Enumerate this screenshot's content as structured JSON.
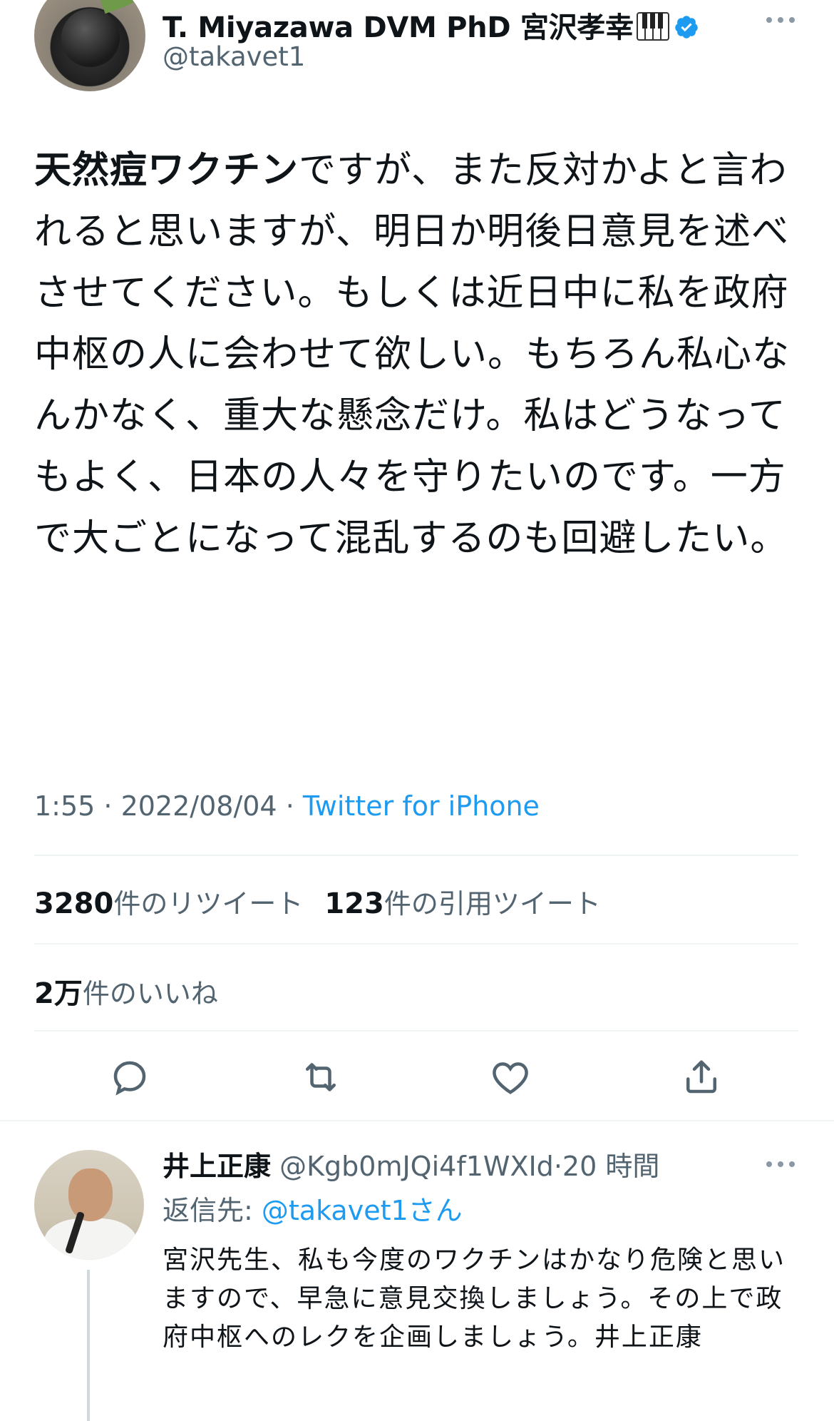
{
  "tweet": {
    "display_name": "T. Miyazawa DVM PhD 宮沢孝幸",
    "handle": "@takavet1",
    "text_bold": "天然痘ワクチン",
    "text_rest": "ですが、また反対かよと言われると思いますが、明日か明後日意見を述べさせてください。もしくは近日中に私を政府中枢の人に会わせて欲しい。もちろん私心なんかなく、重大な懸念だけ。私はどうなってもよく、日本の人々を守りたいのです。一方で大ごとになって混乱するのも回避したい。",
    "time": "1:55",
    "date": "2022/08/04",
    "source": "Twitter for iPhone"
  },
  "stats": {
    "retweets_count": "3280",
    "retweets_label": "件のリツイート",
    "quotes_count": "123",
    "quotes_label": "件の引用ツイート",
    "likes_count": "2万",
    "likes_label": "件のいいね"
  },
  "actions": {
    "reply_icon": "reply-icon",
    "retweet_icon": "retweet-icon",
    "like_icon": "heart-icon",
    "share_icon": "share-icon"
  },
  "reply": {
    "name": "井上正康",
    "handle": "@Kgb0mJQi4f1WXId",
    "time": "20 時間",
    "reply_to_label": "返信先: ",
    "reply_to_mention": "@takavet1さん",
    "text": "宮沢先生、私も今度のワクチンはかなり危険と思いますので、早急に意見交換しましょう。その上で政府中枢へのレクを企画しましょう。井上正康"
  },
  "colors": {
    "text": "#0f1419",
    "secondary": "#536471",
    "link": "#1d9bf0",
    "divider": "#eff3f4"
  }
}
